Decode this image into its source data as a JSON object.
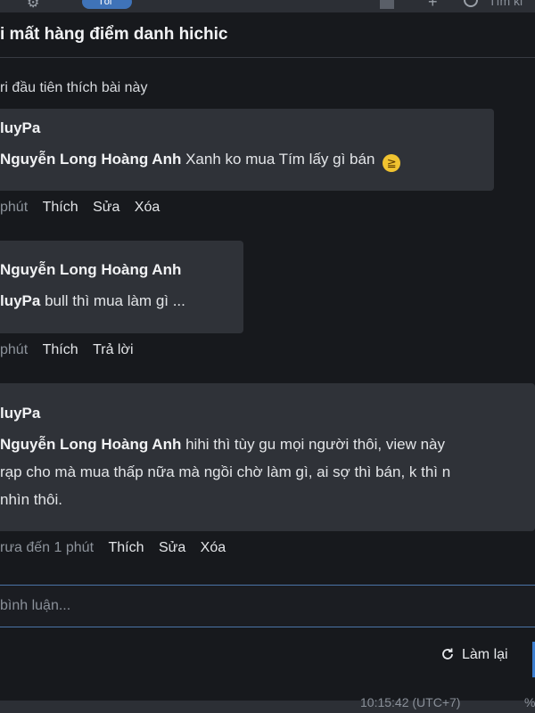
{
  "topbar": {
    "pill_label": "Tối",
    "search_text": "Tìm ki"
  },
  "modal": {
    "title": "i mất hàng điểm danh hichic",
    "likes_text": "ri đầu tiên thích bài này"
  },
  "comments": [
    {
      "author": "luyPa",
      "mention": "Nguyễn Long Hoàng Anh",
      "lines": [
        "Xanh ko mua Tím lấy gì bán"
      ],
      "emoji": "😆",
      "time": "phút",
      "actions": [
        "Thích",
        "Sửa",
        "Xóa"
      ]
    },
    {
      "author": "Nguyễn Long Hoàng Anh",
      "mention": "luyPa",
      "lines": [
        "bull thì mua làm gì ..."
      ],
      "time": "phút",
      "actions": [
        "Thích",
        "Trả lời"
      ]
    },
    {
      "author": "luyPa",
      "mention": "Nguyễn Long Hoàng Anh",
      "lines": [
        "hihi thì tùy gu mọi người thôi, view này",
        "rạp cho mà mua thấp nữa mà ngồi chờ làm gì, ai sợ thì bán, k thì n",
        "nhìn thôi."
      ],
      "time": "rưa đến 1 phút",
      "actions": [
        "Thích",
        "Sửa",
        "Xóa"
      ]
    }
  ],
  "comment_input": {
    "placeholder": "bình luận..."
  },
  "reset_button": {
    "label": "Làm lại"
  },
  "bottombar": {
    "timestamp": "10:15:42 (UTC+7)",
    "percent": "%"
  },
  "colors": {
    "accent": "#3c7ed0",
    "bubble": "#2f3238",
    "background": "#17191d"
  }
}
